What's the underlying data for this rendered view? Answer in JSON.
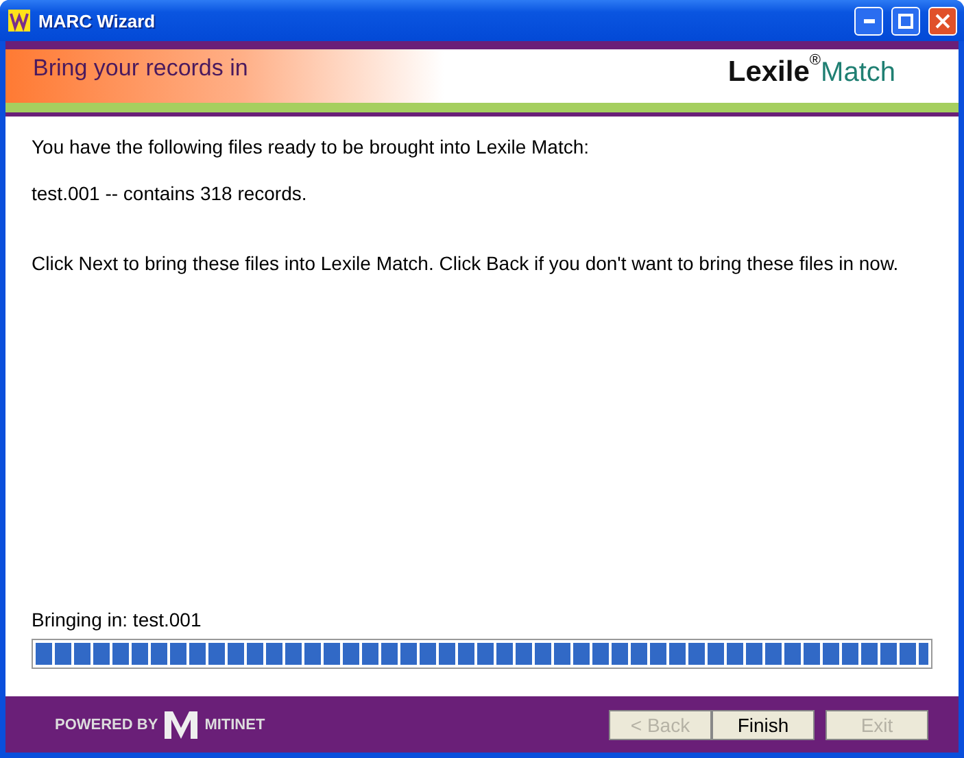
{
  "window": {
    "title": "MARC Wizard"
  },
  "header": {
    "title": "Bring your records in",
    "logo": {
      "part_1": "Lexile",
      "mark": "®",
      "part_2": "Match"
    }
  },
  "body": {
    "paragraphs": [
      "You have the following files ready to be brought into Lexile Match:",
      "test.001 -- contains 318 records.",
      "Click Next to bring these files into Lexile Match. Click Back if you don't want to bring these files in now."
    ]
  },
  "progress": {
    "label": "Bringing in: test.001",
    "level": 1
  },
  "footer": {
    "powered_by": "POWERED BY",
    "brand": "MITINET",
    "buttons": [
      {
        "label": "< Back",
        "disabled": true
      },
      {
        "label": "Finish",
        "disabled": false
      },
      {
        "label": "Exit",
        "disabled": true
      }
    ]
  }
}
